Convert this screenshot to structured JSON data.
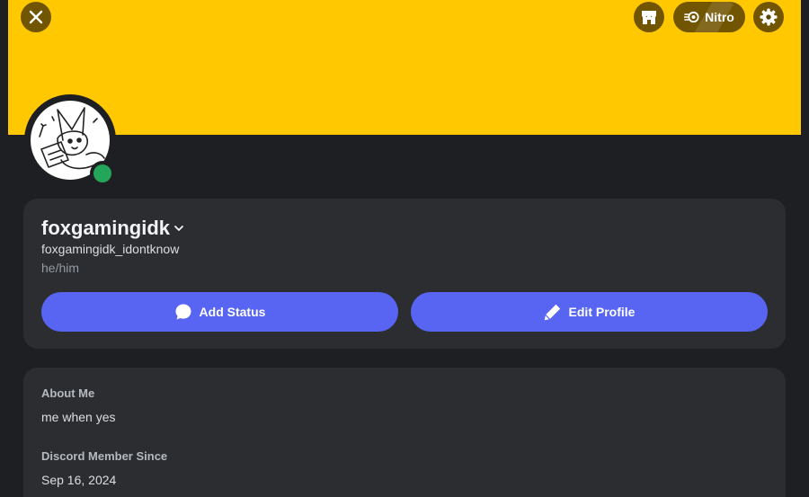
{
  "banner": {
    "color": "#ffc800"
  },
  "header": {
    "close_icon": "close-icon",
    "shop_icon": "shop-icon",
    "nitro_label": "Nitro",
    "settings_icon": "gear-icon"
  },
  "profile": {
    "display_name": "foxgamingidk",
    "username": "foxgamingidk_idontknow",
    "pronouns": "he/him",
    "status": "online",
    "status_color": "#23a55a"
  },
  "actions": {
    "add_status_label": "Add Status",
    "edit_profile_label": "Edit Profile",
    "button_color": "#5865f2"
  },
  "about": {
    "about_label": "About Me",
    "about_text": "me when yes",
    "member_since_label": "Discord Member Since",
    "member_since_value": "Sep 16, 2024"
  }
}
